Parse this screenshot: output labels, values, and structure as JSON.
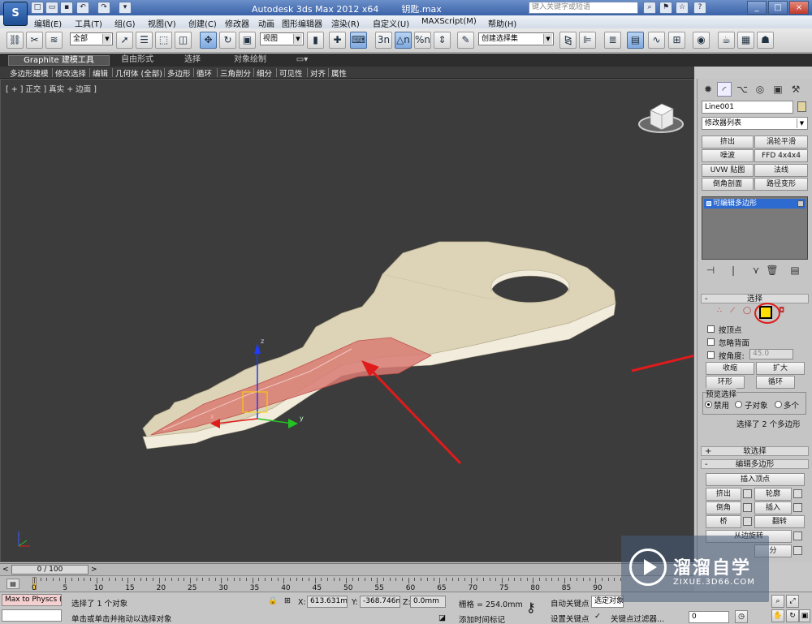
{
  "app": {
    "title_parts": [
      "Autodesk 3ds Max  2012 x64",
      "钥匙.max"
    ],
    "logo_text": "S",
    "search_placeholder": "键入关键字或短语",
    "window_controls": [
      "_",
      "□",
      "×"
    ]
  },
  "menubar": [
    "编辑(E)",
    "工具(T)",
    "组(G)",
    "视图(V)",
    "创建(C)",
    "修改器",
    "动画",
    "图形编辑器",
    "渲染(R)",
    "自定义(U)",
    "MAXScript(M)",
    "帮助(H)"
  ],
  "toolbar": {
    "selection_filter": "全部",
    "reference_coord": "视图",
    "named_selection": "创建选择集",
    "percent_icon": "%n",
    "angle_snap_icon": "△n",
    "snap_icon": "3n"
  },
  "ribbon": {
    "tabs": [
      "Graphite 建模工具",
      "自由形式",
      "选择",
      "对象绘制"
    ],
    "subtools": [
      "多边形建模",
      "修改选择",
      "编辑",
      "几何体 (全部)",
      "多边形",
      "循环",
      "三角剖分",
      "细分",
      "可见性",
      "对齐",
      "属性"
    ]
  },
  "viewport": {
    "label": "[ + ] 正交 ] 真实 + 边面 ]",
    "gizmo_axes": [
      "x",
      "y",
      "z"
    ]
  },
  "command_panel": {
    "object_name": "Line001",
    "modifier_list": "修改器列表",
    "modifier_buttons": [
      "挤出",
      "涡轮平滑",
      "噪波",
      "FFD 4x4x4",
      "UVW 贴图",
      "法线",
      "倒角剖面",
      "路径变形"
    ],
    "stack_item": "可编辑多边形",
    "selection_rollout": "选择",
    "by_vertex": "按顶点",
    "ignore_backfacing": "忽略背面",
    "by_angle": "按角度:",
    "angle_value": "45.0",
    "shrink": "收缩",
    "grow": "扩大",
    "ring": "环形",
    "loop": "循环",
    "preview_selection": "预览选择",
    "preview_disabled": "禁用",
    "preview_subobject": "子对象",
    "preview_multi": "多个",
    "selection_status": "选择了 2 个多边形",
    "soft_selection": "软选择",
    "edit_polygons": "编辑多边形",
    "insert_vertex": "插入顶点",
    "extrude": "挤出",
    "outline": "轮廓",
    "bevel": "倒角",
    "inset": "插入",
    "bridge": "桥",
    "flip": "翻转",
    "hinge_from_edge": "从边旋转",
    "extra_label_1": "分",
    "extra_label_2": "旋转"
  },
  "timeline": {
    "frame_counter": "0 / 100",
    "ticks": [
      "0",
      "5",
      "10",
      "15",
      "20",
      "25",
      "30",
      "35",
      "40",
      "45",
      "50",
      "55",
      "60",
      "65",
      "70",
      "75",
      "80",
      "85",
      "90"
    ]
  },
  "status": {
    "maxscript_listener": "Max to Physcs (",
    "message_1": "选择了 1 个对象",
    "message_2": "单击或单击并拖动以选择对象",
    "x_label": "X:",
    "x_value": "613.631mm",
    "y_label": "Y:",
    "y_value": "-368.746m",
    "z_label": "Z:",
    "z_value": "0.0mm",
    "grid": "栅格 = 254.0mm",
    "auto_key": "自动关键点",
    "auto_key_mode": "选定对象",
    "set_key": "设置关键点",
    "key_filters": "关键点过滤器...",
    "add_time_tag": "添加时间标记",
    "frame_value": "0"
  },
  "watermark": {
    "title": "溜溜自学",
    "url": "ZIXUE.3D66.COM"
  },
  "colors": {
    "viewport_bg": "#3c3c3c",
    "key_body": "#ddd3b6",
    "selected_faces": "#d97b73",
    "annotation_red": "#e01b1b",
    "stack_highlight": "#2e6bd1"
  }
}
